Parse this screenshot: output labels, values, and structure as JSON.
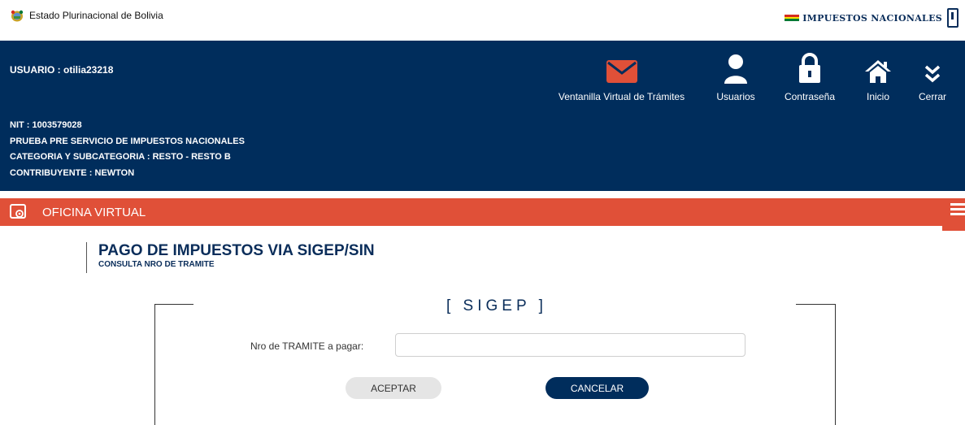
{
  "topbar": {
    "government": "Estado Plurinacional de Bolivia",
    "brand": "IMPUESTOS NACIONALES",
    "flag_colors": [
      "#d52b1e",
      "#f9e300",
      "#007934"
    ]
  },
  "header": {
    "usuario": "USUARIO : otilia23218",
    "nit": "NIT : 1003579028",
    "service": "PRUEBA PRE SERVICIO DE IMPUESTOS NACIONALES",
    "categoria": "CATEGORIA Y SUBCATEGORIA : RESTO - RESTO B",
    "contribuyente": "CONTRIBUYENTE : NEWTON",
    "background": "#002d5c",
    "nav": [
      {
        "label": "Ventanilla Virtual de Trámites",
        "icon": "envelope-icon"
      },
      {
        "label": "Usuarios",
        "icon": "user-icon"
      },
      {
        "label": "Contraseña",
        "icon": "lock-icon"
      },
      {
        "label": "Inicio",
        "icon": "home-icon"
      },
      {
        "label": "Cerrar",
        "icon": "double-chevron-down-icon"
      }
    ]
  },
  "oficina": {
    "title": "OFICINA VIRTUAL",
    "color": "#e05038"
  },
  "page": {
    "title": "PAGO DE IMPUESTOS VIA SIGEP/SIN",
    "subtitle": "CONSULTA NRO DE TRAMITE"
  },
  "form": {
    "legend": "[ SIGEP ]",
    "tramite_label": "Nro de TRAMITE a pagar:",
    "tramite_value": "",
    "accept_label": "ACEPTAR",
    "cancel_label": "CANCELAR"
  }
}
